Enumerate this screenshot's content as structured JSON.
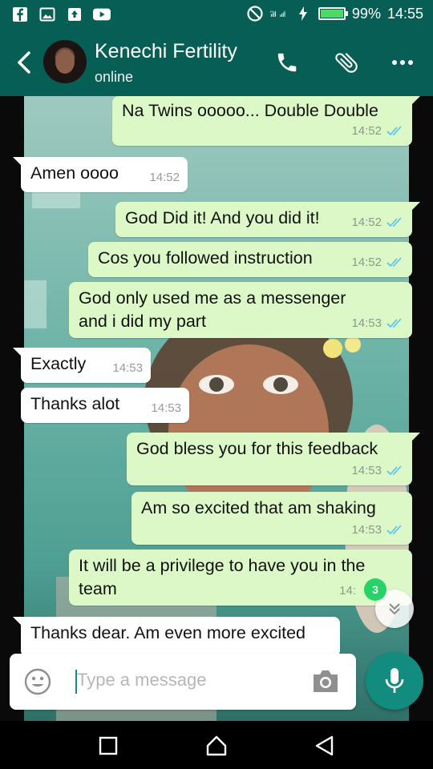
{
  "status_bar": {
    "battery_percent_text": "99%",
    "battery_level": 0.99,
    "time": "14:55",
    "network": "H+",
    "icons": [
      "facebook-icon",
      "gallery-icon",
      "upload-icon",
      "youtube-icon",
      "do-not-disturb-icon",
      "signal-icon",
      "charging-icon",
      "battery-icon"
    ]
  },
  "header": {
    "contact_name": "Kenechi Fertility",
    "status": "online",
    "icons": [
      "back-arrow-icon",
      "phone-icon",
      "attach-icon",
      "more-icon"
    ]
  },
  "messages": [
    {
      "direction": "out",
      "text": "Na Twins ooooo... Double Double",
      "time": "14:52",
      "read": true
    },
    {
      "direction": "in",
      "text": "Amen oooo",
      "time": "14:52"
    },
    {
      "direction": "out",
      "text": "God Did it! And you did it!",
      "time": "14:52",
      "read": true
    },
    {
      "direction": "out",
      "text": "Cos you followed instruction",
      "time": "14:52",
      "read": true
    },
    {
      "direction": "out",
      "text_line1": "God only used me as a messenger",
      "text_line2": "and i did my part",
      "time": "14:53",
      "read": true
    },
    {
      "direction": "in",
      "text": "Exactly",
      "time": "14:53"
    },
    {
      "direction": "in",
      "text": "Thanks alot",
      "time": "14:53"
    },
    {
      "direction": "out",
      "text": "God bless you for this feedback",
      "time": "14:53",
      "read": true
    },
    {
      "direction": "out",
      "text": "Am so excited that am shaking",
      "time": "14:53",
      "read": true
    },
    {
      "direction": "out",
      "text_line1": "It will be a privilege to have you in the",
      "text_line2": "team",
      "time": "14:",
      "read": true
    },
    {
      "direction": "in",
      "text": "Thanks dear. Am even more excited"
    }
  ],
  "scroll_to_bottom": {
    "unread_count": "3"
  },
  "input": {
    "placeholder": "Type a message"
  },
  "colors": {
    "header": "#075e54",
    "outgoing_bubble": "#dcf8c6",
    "incoming_bubble": "#ffffff",
    "accent": "#128c7e",
    "unread_badge": "#25d366"
  }
}
